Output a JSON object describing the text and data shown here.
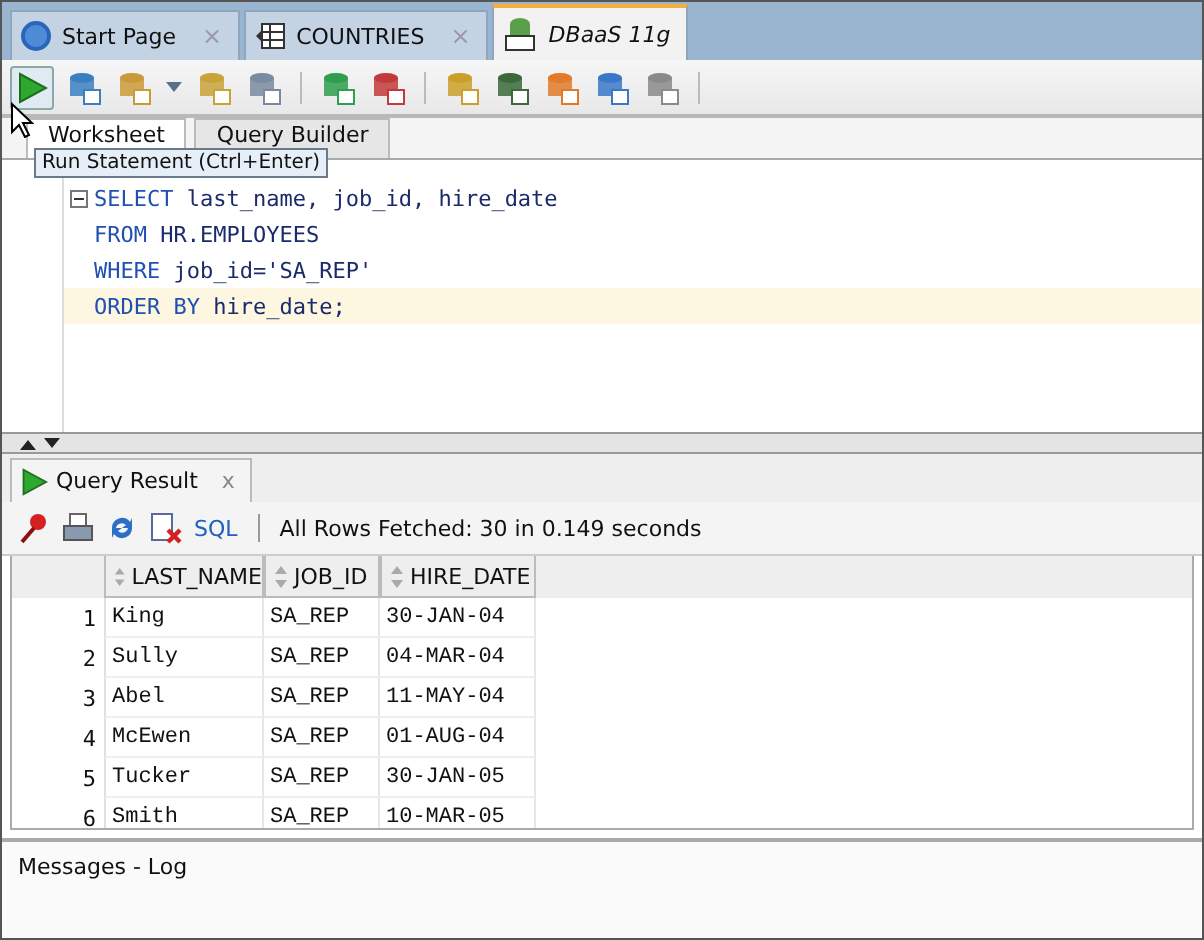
{
  "doc_tabs": [
    {
      "label": "Start Page",
      "kind": "help",
      "selected": false,
      "close": "×"
    },
    {
      "label": "COUNTRIES",
      "kind": "table",
      "selected": false,
      "close": "×"
    },
    {
      "label": "DBaaS 11g",
      "kind": "sql",
      "selected": true
    }
  ],
  "tooltip": "Run Statement (Ctrl+Enter)",
  "editor_tabs": [
    {
      "label": "Worksheet",
      "selected": true
    },
    {
      "label": "Query Builder",
      "selected": false
    }
  ],
  "sql_lines": [
    {
      "keyword": "SELECT",
      "rest": " last_name, job_id, hire_date",
      "current": false
    },
    {
      "keyword": "FROM",
      "rest": " HR.EMPLOYEES",
      "current": false
    },
    {
      "keyword": "WHERE",
      "rest": " job_id='SA_REP'",
      "current": false
    },
    {
      "keyword": "ORDER BY",
      "rest": " hire_date;",
      "current": true
    }
  ],
  "result_tab": {
    "label": "Query Result",
    "close": "x"
  },
  "result_toolbar": {
    "sql_link": "SQL",
    "status": "All Rows Fetched: 30 in 0.149 seconds"
  },
  "table": {
    "columns": [
      "",
      "LAST_NAME",
      "JOB_ID",
      "HIRE_DATE"
    ],
    "rows": [
      [
        "1",
        "King",
        "SA_REP",
        "30-JAN-04"
      ],
      [
        "2",
        "Sully",
        "SA_REP",
        "04-MAR-04"
      ],
      [
        "3",
        "Abel",
        "SA_REP",
        "11-MAY-04"
      ],
      [
        "4",
        "McEwen",
        "SA_REP",
        "01-AUG-04"
      ],
      [
        "5",
        "Tucker",
        "SA_REP",
        "30-JAN-05"
      ],
      [
        "6",
        "Smith",
        "SA_REP",
        "10-MAR-05"
      ]
    ]
  },
  "messages_panel": {
    "title": "Messages - Log"
  }
}
